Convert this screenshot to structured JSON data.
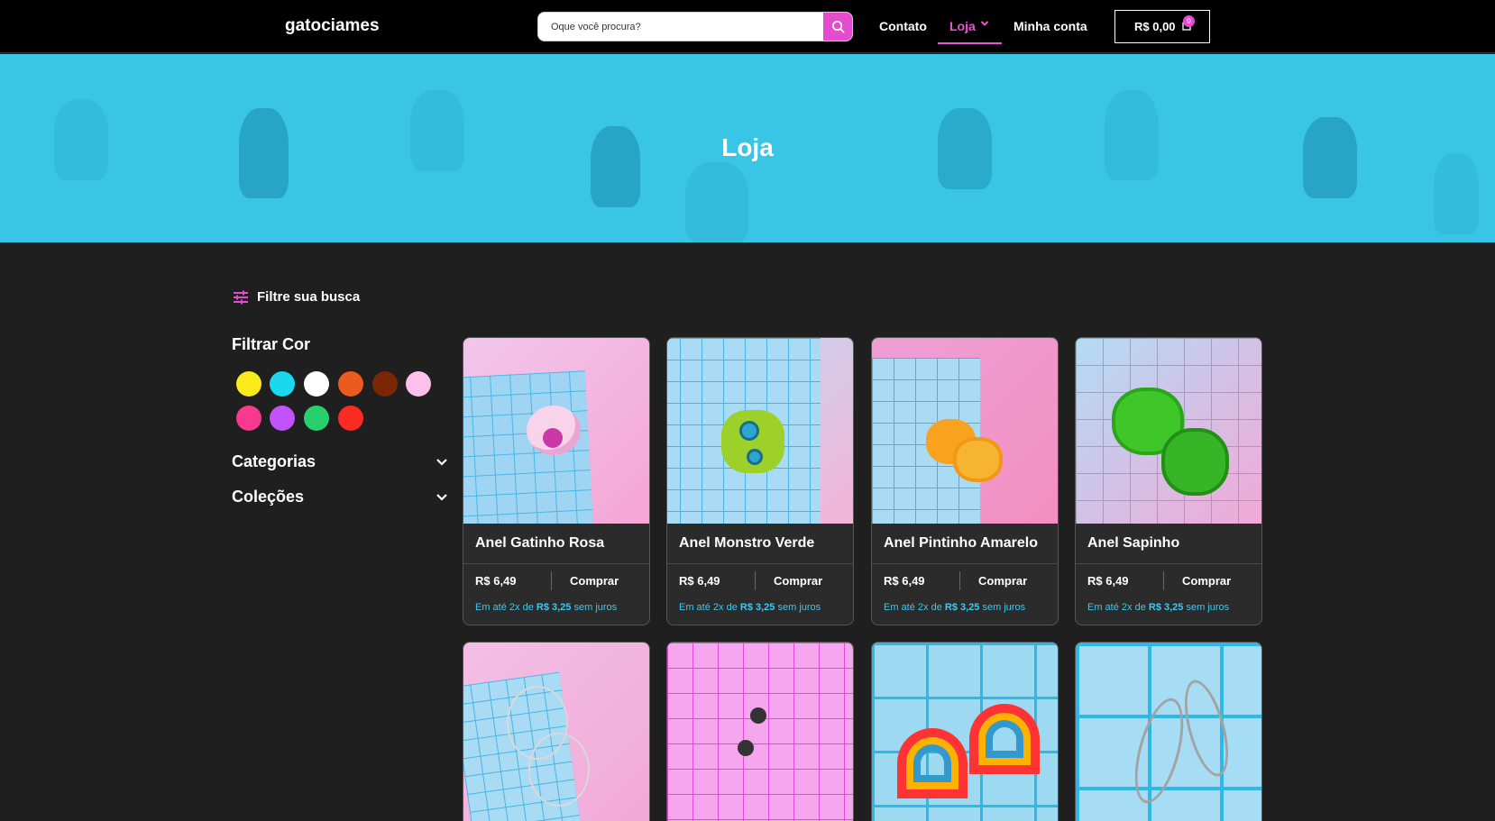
{
  "header": {
    "logo": "gatociames",
    "search_placeholder": "Oque você procura?",
    "nav": {
      "contato": "Contato",
      "loja": "Loja",
      "conta": "Minha conta"
    },
    "cart_total": "R$ 0,00",
    "cart_count": "0",
    "accent_color": "#e44ccf"
  },
  "hero": {
    "title": "Loja",
    "background_color": "#39c6e6"
  },
  "sidebar": {
    "filter_title": "Filtre sua busca",
    "color_filter_title": "Filtrar Cor",
    "colors": [
      "#fbea1b",
      "#19d8ef",
      "#ffffff",
      "#ec5a1e",
      "#7b2605",
      "#fdc0ec",
      "#f9398f",
      "#c153f9",
      "#28cf6d",
      "#fb2a23"
    ],
    "categories": "Categorias",
    "collections": "Coleções"
  },
  "products": [
    {
      "name": "Anel Gatinho Rosa",
      "price": "R$ 6,49",
      "buy": "Comprar",
      "inst_prefix": "Em até 2x de",
      "inst_value": "R$ 3,25",
      "inst_suffix": "sem juros"
    },
    {
      "name": "Anel Monstro Verde",
      "price": "R$ 6,49",
      "buy": "Comprar",
      "inst_prefix": "Em até 2x de",
      "inst_value": "R$ 3,25",
      "inst_suffix": "sem juros"
    },
    {
      "name": "Anel Pintinho Amarelo",
      "price": "R$ 6,49",
      "buy": "Comprar",
      "inst_prefix": "Em até 2x de",
      "inst_value": "R$ 3,25",
      "inst_suffix": "sem juros"
    },
    {
      "name": "Anel Sapinho",
      "price": "R$ 6,49",
      "buy": "Comprar",
      "inst_prefix": "Em até 2x de",
      "inst_value": "R$ 3,25",
      "inst_suffix": "sem juros"
    }
  ]
}
